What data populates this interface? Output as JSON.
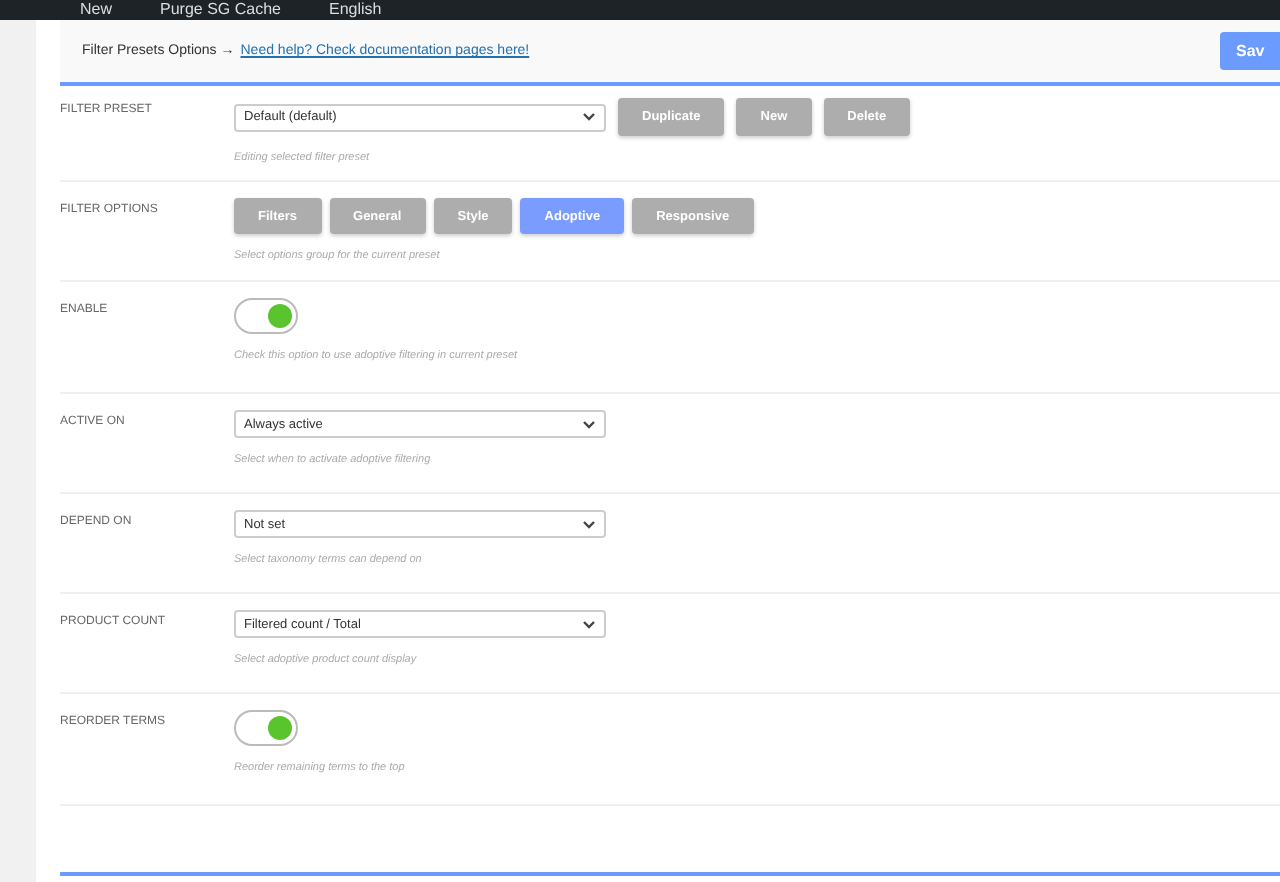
{
  "admin_bar": {
    "items": [
      "New",
      "Purge SG Cache",
      "English"
    ]
  },
  "header": {
    "title": "Filter Presets Options →",
    "help_link": "Need help? Check documentation pages here!",
    "save_button": "Sav"
  },
  "rows": [
    {
      "label": "FILTER PRESET",
      "kind": "select",
      "value": "Default (default)",
      "buttons": [
        "Duplicate",
        "New",
        "Delete"
      ],
      "hint": "Editing selected filter preset"
    },
    {
      "label": "FILTER OPTIONS",
      "kind": "tabs",
      "tabs": [
        {
          "label": "Filters",
          "selected": false
        },
        {
          "label": "General",
          "selected": false
        },
        {
          "label": "Style",
          "selected": false
        },
        {
          "label": "Adoptive",
          "selected": true
        },
        {
          "label": "Responsive",
          "selected": false
        }
      ],
      "hint": "Select options group for the current preset"
    },
    {
      "label": "ENABLE",
      "kind": "toggle",
      "on": true,
      "hint": "Check this option to use adoptive filtering in current preset"
    },
    {
      "label": "ACTIVE ON",
      "kind": "select",
      "value": "Always active",
      "hint": "Select when to activate adoptive filtering"
    },
    {
      "label": "DEPEND ON",
      "kind": "select",
      "value": "Not set",
      "hint": "Select taxonomy terms can depend on"
    },
    {
      "label": "PRODUCT COUNT",
      "kind": "select",
      "value": "Filtered count / Total",
      "hint": "Select adoptive product count display"
    },
    {
      "label": "REORDER TERMS",
      "kind": "toggle",
      "on": true,
      "hint": "Reorder remaining terms to the top"
    }
  ]
}
